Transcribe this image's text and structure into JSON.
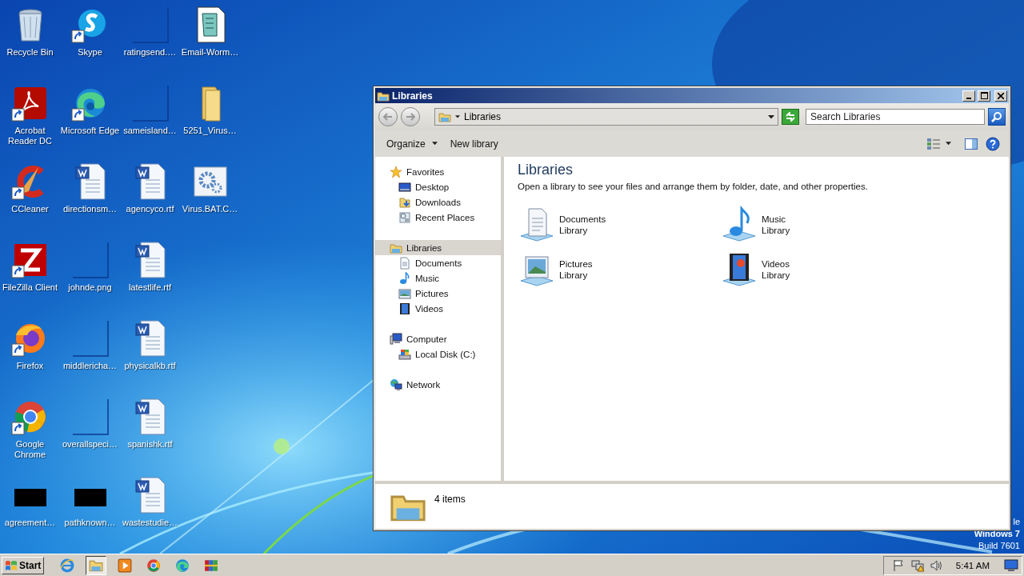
{
  "desktop_icons": [
    {
      "label": "Recycle Bin",
      "kind": "recycle-bin",
      "shortcut": false
    },
    {
      "label": "Acrobat Reader DC",
      "kind": "acrobat",
      "shortcut": true
    },
    {
      "label": "CCleaner",
      "kind": "ccleaner",
      "shortcut": true
    },
    {
      "label": "FileZilla Client",
      "kind": "filezilla",
      "shortcut": true
    },
    {
      "label": "Firefox",
      "kind": "firefox",
      "shortcut": true
    },
    {
      "label": "Google Chrome",
      "kind": "chrome",
      "shortcut": true
    },
    {
      "label": "agreement…",
      "kind": "black",
      "shortcut": false
    },
    {
      "label": "Skype",
      "kind": "skype",
      "shortcut": true
    },
    {
      "label": "Microsoft Edge",
      "kind": "edge",
      "shortcut": true
    },
    {
      "label": "directionsm…",
      "kind": "word",
      "shortcut": false
    },
    {
      "label": "johnde.png",
      "kind": "blank",
      "shortcut": false
    },
    {
      "label": "middlericha…",
      "kind": "blank",
      "shortcut": false
    },
    {
      "label": "overallspeci…",
      "kind": "blank",
      "shortcut": false
    },
    {
      "label": "pathknown…",
      "kind": "black",
      "shortcut": false
    },
    {
      "label": "ratingsend.…",
      "kind": "blank",
      "shortcut": false
    },
    {
      "label": "sameisland…",
      "kind": "blank",
      "shortcut": false
    },
    {
      "label": "agencyco.rtf",
      "kind": "word",
      "shortcut": false
    },
    {
      "label": "latestlife.rtf",
      "kind": "word",
      "shortcut": false
    },
    {
      "label": "physicalkb.rtf",
      "kind": "word",
      "shortcut": false
    },
    {
      "label": "spanishk.rtf",
      "kind": "word",
      "shortcut": false
    },
    {
      "label": "wastestudie…",
      "kind": "word",
      "shortcut": false
    },
    {
      "label": "Email-Worm…",
      "kind": "script",
      "shortcut": false
    },
    {
      "label": "5251_Virus…",
      "kind": "folder",
      "shortcut": false
    },
    {
      "label": "Virus.BAT.C…",
      "kind": "gear",
      "shortcut": false
    }
  ],
  "os_notice": [
    "le",
    "Windows 7",
    "Build 7601"
  ],
  "window": {
    "title": "Libraries",
    "address": "Libraries",
    "search": {
      "placeholder": "Search Libraries"
    },
    "toolbar": [
      {
        "label": "Organize",
        "dropdown": true
      },
      {
        "label": "New library",
        "dropdown": false
      }
    ],
    "nav": [
      {
        "label": "Favorites",
        "kind": "star",
        "selected": false,
        "children": [
          {
            "label": "Desktop",
            "kind": "desktop",
            "selected": false
          },
          {
            "label": "Downloads",
            "kind": "downloads",
            "selected": false
          },
          {
            "label": "Recent Places",
            "kind": "recent",
            "selected": false
          }
        ]
      },
      {
        "label": "Libraries",
        "kind": "library",
        "selected": true,
        "children": [
          {
            "label": "Documents",
            "kind": "documents",
            "selected": false
          },
          {
            "label": "Music",
            "kind": "music",
            "selected": false
          },
          {
            "label": "Pictures",
            "kind": "pictures",
            "selected": false
          },
          {
            "label": "Videos",
            "kind": "videos",
            "selected": false
          }
        ]
      },
      {
        "label": "Computer",
        "kind": "computer",
        "selected": false,
        "children": [
          {
            "label": "Local Disk (C:)",
            "kind": "disk",
            "selected": false
          }
        ]
      },
      {
        "label": "Network",
        "kind": "network",
        "selected": false
      }
    ],
    "heading": "Libraries",
    "description": "Open a library to see your files and arrange them by folder, date, and other properties.",
    "libraries": [
      {
        "name": "Documents",
        "subtitle": "Library",
        "kind": "documents"
      },
      {
        "name": "Music",
        "subtitle": "Library",
        "kind": "music"
      },
      {
        "name": "Pictures",
        "subtitle": "Library",
        "kind": "pictures"
      },
      {
        "name": "Videos",
        "subtitle": "Library",
        "kind": "videos"
      }
    ],
    "status": "4 items"
  },
  "taskbar": {
    "start": "Start",
    "apps": [
      {
        "kind": "ie",
        "selected": false
      },
      {
        "kind": "explorer",
        "selected": true
      },
      {
        "kind": "media",
        "selected": false
      },
      {
        "kind": "chrome",
        "selected": false
      },
      {
        "kind": "edge",
        "selected": false
      },
      {
        "kind": "winrar",
        "selected": false
      }
    ],
    "clock": "5:41 AM"
  }
}
